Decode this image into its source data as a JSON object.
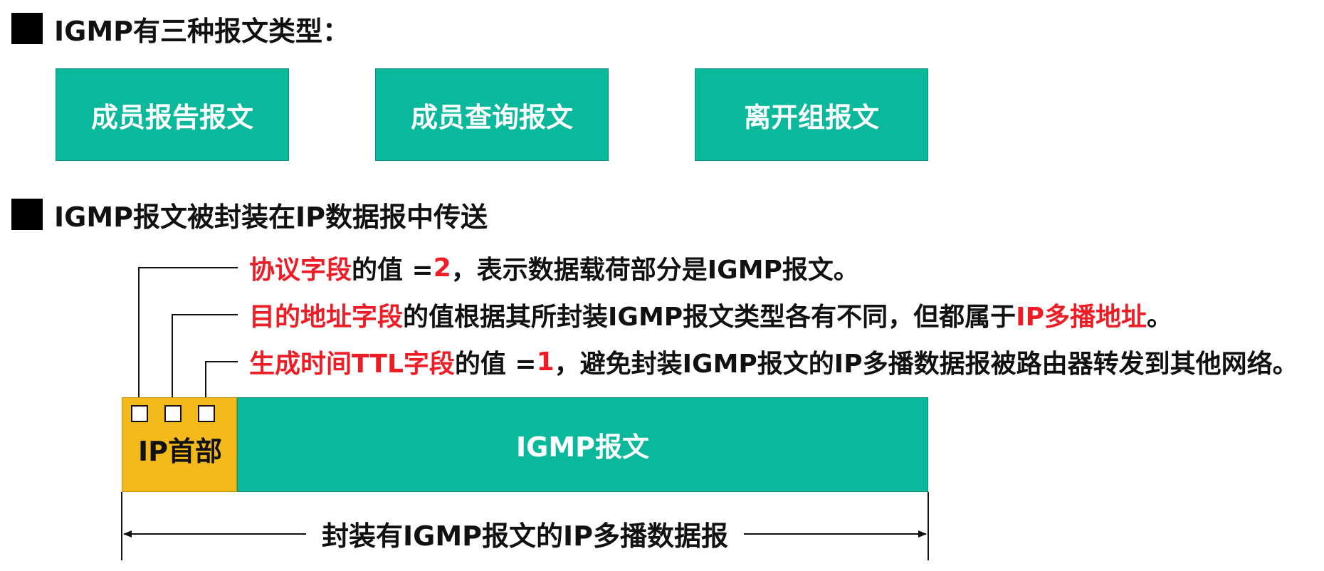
{
  "section1": {
    "heading": "IGMP有三种报文类型："
  },
  "message_types": [
    "成员报告报文",
    "成员查询报文",
    "离开组报文"
  ],
  "section2": {
    "heading": "IGMP报文被封装在IP数据报中传送"
  },
  "fields": [
    {
      "name": "协议字段",
      "text_a": "的值 = ",
      "value": "2",
      "text_b": "，表示数据载荷部分是IGMP报文。"
    },
    {
      "name": "目的地址字段",
      "text_a": "的值根据其所封装IGMP报文类型各有不同，但都属于",
      "highlight": "IP多播地址",
      "text_b": "。"
    },
    {
      "name": "生成时间TTL字段",
      "text_a": "的值 = ",
      "value": "1",
      "text_b": "，避免封装IGMP报文的IP多播数据报被路由器转发到其他网络。"
    }
  ],
  "datagram": {
    "header_label": "IP首部",
    "payload_label": "IGMP报文",
    "span_label": "封装有IGMP报文的IP多播数据报"
  },
  "colors": {
    "teal": "#0ab99b",
    "gold": "#f4b91a",
    "red": "#ee1c25"
  }
}
